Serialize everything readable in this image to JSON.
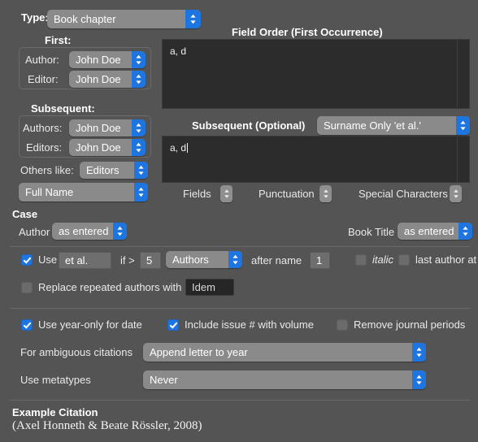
{
  "type_row": {
    "label": "Type:",
    "value": "Book chapter"
  },
  "first_group": {
    "title": "First:",
    "author_label": "Author:",
    "author_value": "John Doe",
    "editor_label": "Editor:",
    "editor_value": "John Doe"
  },
  "subsequent_group": {
    "title": "Subsequent:",
    "authors_label": "Authors:",
    "authors_value": "John Doe",
    "editors_label": "Editors:",
    "editors_value": "John Doe"
  },
  "others_like": {
    "label": "Others like:",
    "value": "Editors",
    "name_format": "Full Name"
  },
  "field_order": {
    "title": "Field Order (First Occurrence)",
    "content": "a, d"
  },
  "subsequent_optional": {
    "label": "Subsequent (Optional)",
    "mode": "Surname Only  'et al.'",
    "content": "a, d"
  },
  "insert_steppers": [
    {
      "label": "Fields"
    },
    {
      "label": "Punctuation"
    },
    {
      "label": "Special Characters"
    }
  ],
  "case_section": {
    "title": "Case",
    "author_label": "Author",
    "author_value": "as entered",
    "book_title_label": "Book Title",
    "book_title_value": "as entered"
  },
  "etal_row": {
    "use_checked": true,
    "use_label": "Use",
    "etal_value": "et al.",
    "if_label": "if >",
    "threshold": "5",
    "scope": "Authors",
    "after_name_label": "after name",
    "after_name_value": "1",
    "italic_checked": false,
    "italic_label": "italic",
    "last_author_checked": false,
    "last_author_label": "last author at end"
  },
  "replace_row": {
    "checked": false,
    "label": "Replace repeated authors with",
    "value": "Idem"
  },
  "option_checkboxes": [
    {
      "label": "Use year-only for date",
      "checked": true
    },
    {
      "label": "Include issue # with volume",
      "checked": true
    },
    {
      "label": "Remove journal periods",
      "checked": false
    }
  ],
  "ambiguous": {
    "label": "For ambiguous citations",
    "value": "Append letter to year"
  },
  "metatypes": {
    "label": "Use metatypes",
    "value": "Never"
  },
  "example": {
    "title": "Example Citation",
    "citation": "(Axel Honneth & Beate Rössler, 2008)"
  },
  "colors": {
    "window_bg": "#545454",
    "accent_blue": "#1f75e0",
    "popup_bg": "#8a8a8a",
    "textarea_bg": "#2c2c2c"
  }
}
